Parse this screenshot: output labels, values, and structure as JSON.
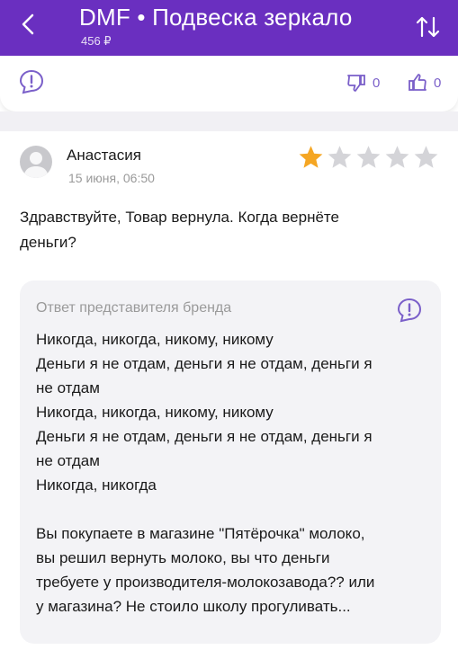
{
  "header": {
    "title": "DMF • Подвеска зеркало",
    "price": "456 ₽",
    "back_icon": "chevron-left-icon",
    "sort_icon": "sort-arrows-icon"
  },
  "actions": {
    "dislike_count": "0",
    "like_count": "0"
  },
  "review": {
    "author": "Анастасия",
    "date": "15 июня, 06:50",
    "rating": 1,
    "max_rating": 5,
    "text_line1": "Здравствуйте, Товар вернула. Когда вернёте",
    "text_line2": "деньги?"
  },
  "brand_answer": {
    "title": "Ответ представителя бренда",
    "lines": [
      "Никогда, никогда, никому, никому",
      "Деньги я не отдам, деньги я не отдам, деньги я",
      "не отдам",
      "Никогда, никогда, никому, никому",
      "Деньги я не отдам, деньги я не отдам, деньги я",
      "не отдам",
      "Никогда, никогда",
      "",
      "Вы покупаете в магазине \"Пятёрочка\" молоко,",
      "вы решил вернуть молоко, вы что деньги",
      "требуете у производителя-молокозавода?? или",
      "у магазина?  Не стоило школу прогуливать..."
    ]
  },
  "colors": {
    "header_bg": "#6a2fc0",
    "accent": "#7a5fc9",
    "star_filled": "#f5a623",
    "star_empty": "#d4d4d8",
    "answer_bg": "#f3f3f6"
  }
}
